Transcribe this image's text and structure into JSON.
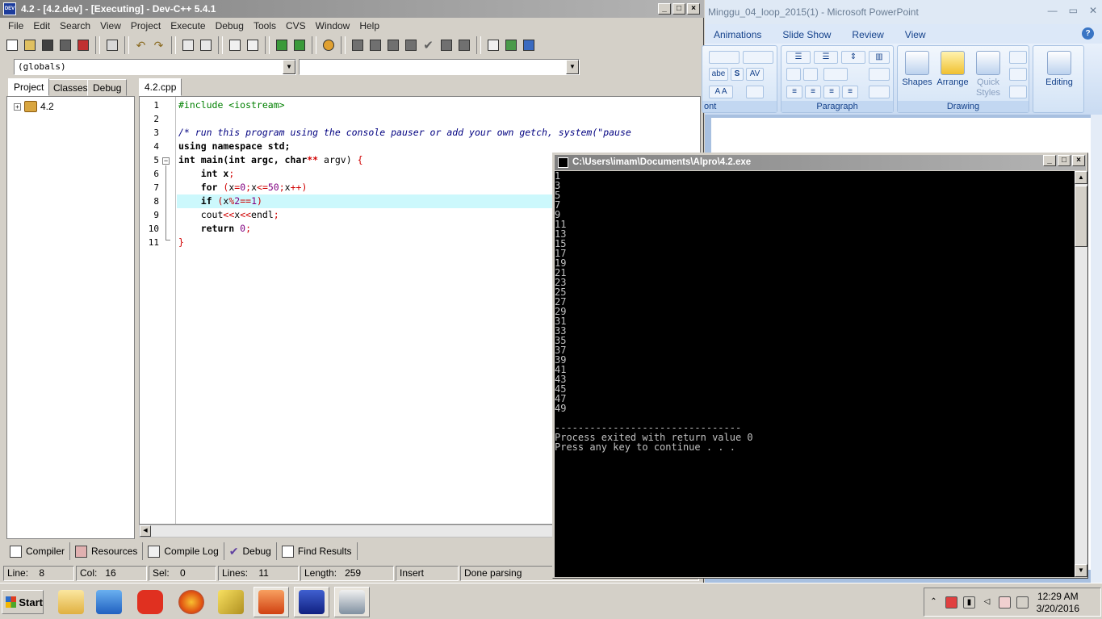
{
  "devcpp": {
    "title": "4.2 - [4.2.dev] - [Executing] - Dev-C++ 5.4.1",
    "app_icon_text": "DEV",
    "menu": [
      "File",
      "Edit",
      "Search",
      "View",
      "Project",
      "Execute",
      "Debug",
      "Tools",
      "CVS",
      "Window",
      "Help"
    ],
    "scope_combo": "(globals)",
    "left_tabs": [
      "Project",
      "Classes",
      "Debug"
    ],
    "tree_root": "4.2",
    "editor_tab": "4.2.cpp",
    "line_numbers": [
      "1",
      "2",
      "3",
      "4",
      "5",
      "6",
      "7",
      "8",
      "9",
      "10",
      "11"
    ],
    "code": {
      "l1": "#include <iostream>",
      "l3": "/* run this program using the console pauser or add your own getch, system(\"pause",
      "l4": "using namespace std;",
      "l5a": "int main(int argc, char",
      "l5b": "**",
      "l5c": " argv) ",
      "l5d": "{",
      "l6a": "    int x",
      "l6b": ";",
      "l7a": "    for ",
      "l7b": "(",
      "l7c": "x",
      "l7d": "=",
      "l7e": "0",
      "l7f": ";",
      "l7g": "x",
      "l7h": "<=",
      "l7i": "50",
      "l7j": ";",
      "l7k": "x",
      "l7l": "++)",
      "l8a": "    if ",
      "l8b": "(",
      "l8c": "x",
      "l8d": "%",
      "l8e": "2",
      "l8f": "==",
      "l8g": "1",
      "l8h": ")",
      "l9a": "    cout",
      "l9b": "<<",
      "l9c": "x",
      "l9d": "<<",
      "l9e": "endl",
      "l9f": ";",
      "l10a": "    return ",
      "l10b": "0",
      "l10c": ";",
      "l11": "}"
    },
    "bottom_tabs": [
      "Compiler",
      "Resources",
      "Compile Log",
      "Debug",
      "Find Results"
    ],
    "status": {
      "line_label": "Line:",
      "line_value": "8",
      "col_label": "Col:",
      "col_value": "16",
      "sel_label": "Sel:",
      "sel_value": "0",
      "lines_label": "Lines:",
      "lines_value": "11",
      "length_label": "Length:",
      "length_value": "259",
      "mode": "Insert",
      "state": "Done parsing"
    }
  },
  "console": {
    "title": "C:\\Users\\imam\\Documents\\Alpro\\4.2.exe",
    "lines": [
      "1",
      "3",
      "5",
      "7",
      "9",
      "11",
      "13",
      "15",
      "17",
      "19",
      "21",
      "23",
      "25",
      "27",
      "29",
      "31",
      "33",
      "35",
      "37",
      "39",
      "41",
      "43",
      "45",
      "47",
      "49",
      "",
      "--------------------------------",
      "Process exited with return value 0",
      "Press any key to continue . . ."
    ]
  },
  "powerpoint": {
    "title": "Minggu_04_loop_2015(1) - Microsoft PowerPoint",
    "tabs": [
      "Animations",
      "Slide Show",
      "Review",
      "View"
    ],
    "help": "?",
    "groups": {
      "font_partial": "ont",
      "paragraph": "Paragraph",
      "drawing": "Drawing"
    },
    "buttons": {
      "shapes": "Shapes",
      "arrange": "Arrange",
      "quick_styles": "Quick Styles",
      "editing": "Editing"
    },
    "font_mini": [
      "abe",
      "S",
      "AV"
    ]
  },
  "taskbar": {
    "start": "Start",
    "time": "12:29 AM",
    "date": "3/20/2016"
  },
  "colors": {
    "title_gray": "#808080",
    "editor_highlight": "#ccf8fc",
    "code_red": "#d00000",
    "code_green": "#008000",
    "console_bg": "#000000",
    "ribbon_blue": "#15428b"
  }
}
